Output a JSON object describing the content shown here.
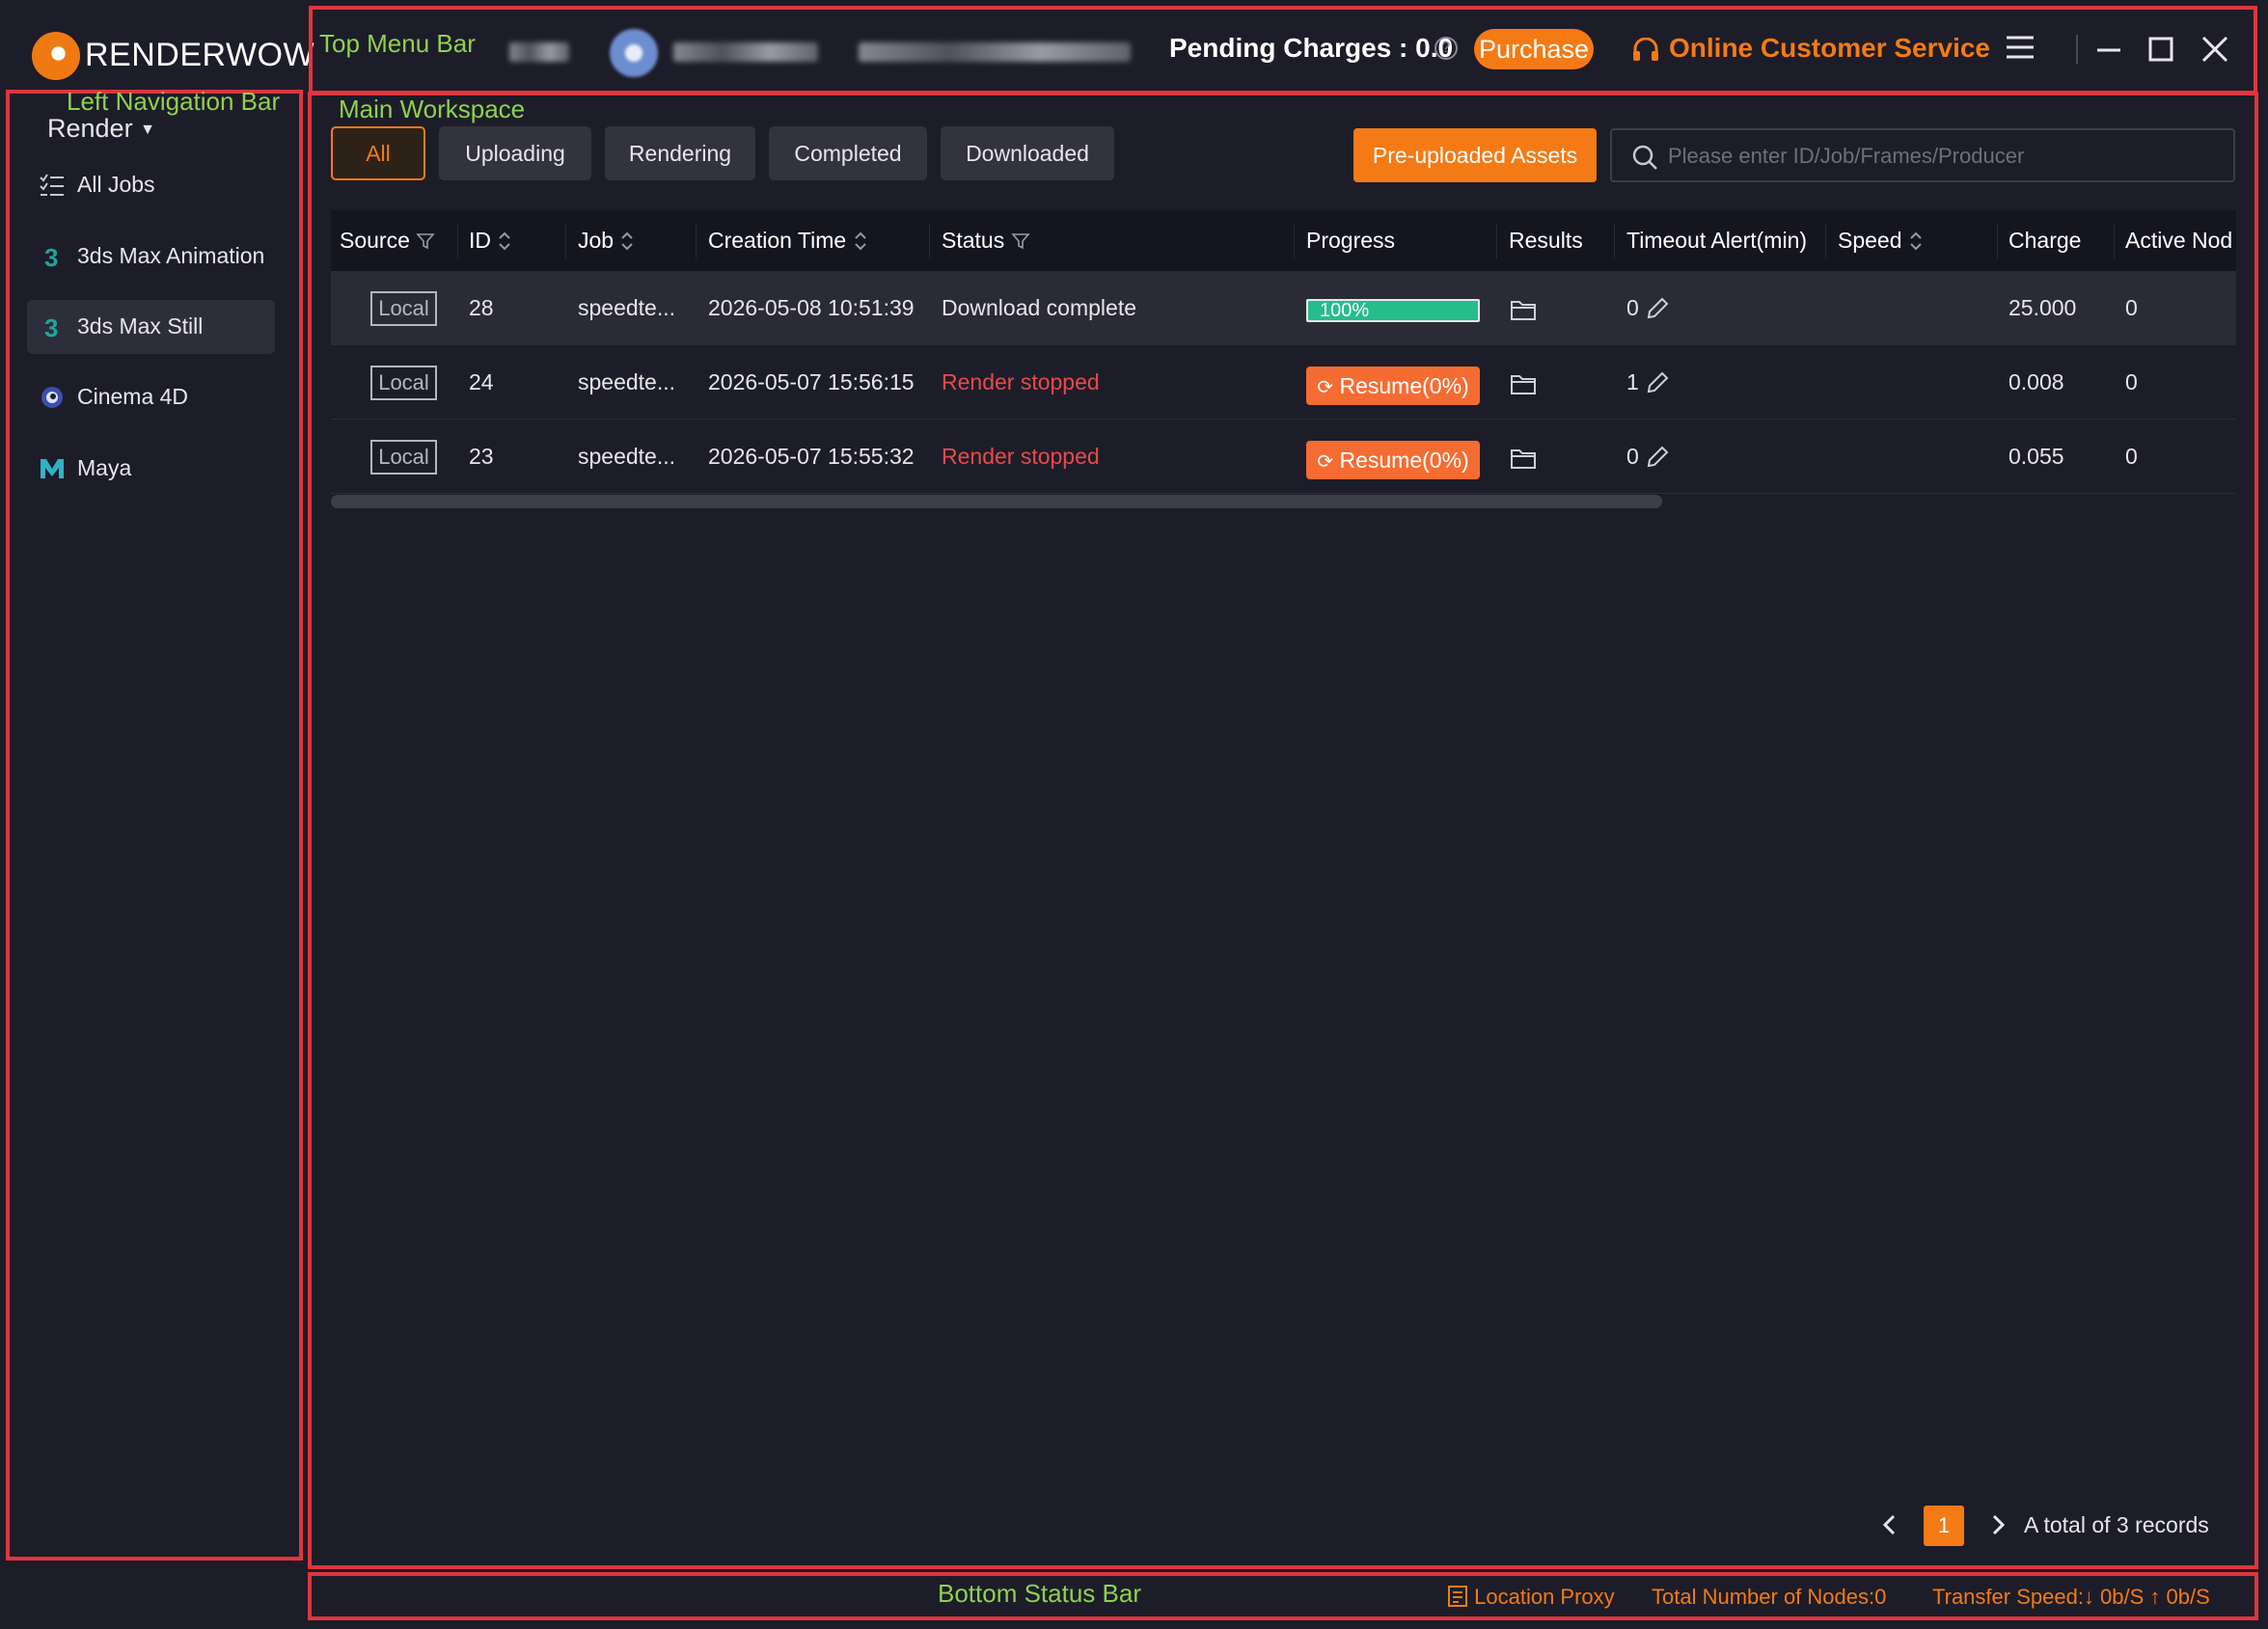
{
  "app": {
    "logo_text": "RENDERWOW"
  },
  "annotations": {
    "top_menu_bar": "Top Menu Bar",
    "left_navigation_bar": "Left Navigation Bar",
    "main_workspace": "Main Workspace",
    "bottom_status_bar": "Bottom Status Bar"
  },
  "topbar": {
    "pending_label": "Pending Charges : 0.0",
    "help_icon": "?",
    "purchase_label": "Purchase",
    "customer_service_label": "Online Customer Service"
  },
  "sidebar": {
    "section": "Render",
    "items": [
      {
        "label": "All Jobs",
        "icon": "list-icon",
        "active": false
      },
      {
        "label": "3ds Max Animation",
        "icon": "3ds-max-icon",
        "active": false
      },
      {
        "label": "3ds Max Still",
        "icon": "3ds-max-icon",
        "active": true
      },
      {
        "label": "Cinema 4D",
        "icon": "cinema4d-icon",
        "active": false
      },
      {
        "label": "Maya",
        "icon": "maya-icon",
        "active": false
      }
    ]
  },
  "filters": {
    "tabs": [
      "All",
      "Uploading",
      "Rendering",
      "Completed",
      "Downloaded"
    ],
    "active": "All",
    "preuploaded_label": "Pre-uploaded Assets",
    "search_placeholder": "Please enter ID/Job/Frames/Producer"
  },
  "table": {
    "columns": [
      "Source",
      "ID",
      "Job",
      "Creation Time",
      "Status",
      "Progress",
      "Results",
      "Timeout Alert(min)",
      "Speed",
      "Charge",
      "Active Nod"
    ],
    "rows": [
      {
        "source": "Local",
        "id": "28",
        "job": "speedte...",
        "created": "2026-05-08 10:51:39",
        "status": "Download complete",
        "progress": "100%",
        "progress_value": 100,
        "timeout": "0",
        "speed": "",
        "charge": "25.000",
        "active_nodes": "0"
      },
      {
        "source": "Local",
        "id": "24",
        "job": "speedte...",
        "created": "2026-05-07 15:56:15",
        "status": "Render stopped",
        "progress": "Resume(0%)",
        "progress_value": 0,
        "timeout": "1",
        "speed": "",
        "charge": "0.008",
        "active_nodes": "0"
      },
      {
        "source": "Local",
        "id": "23",
        "job": "speedte...",
        "created": "2026-05-07 15:55:32",
        "status": "Render stopped",
        "progress": "Resume(0%)",
        "progress_value": 0,
        "timeout": "0",
        "speed": "",
        "charge": "0.055",
        "active_nodes": "0"
      }
    ]
  },
  "pagination": {
    "current_page": "1",
    "total_text": "A total of 3 records"
  },
  "statusbar": {
    "location_proxy": "Location Proxy",
    "total_nodes": "Total Number of Nodes:0",
    "transfer_speed": "Transfer Speed:↓ 0b/S ↑ 0b/S"
  },
  "colors": {
    "accent": "#f47a15",
    "background": "#1d1d29",
    "error": "#e84a4a",
    "success": "#26bd8b",
    "annotation": "#e0353d",
    "annotation_label": "#8fd14f"
  }
}
